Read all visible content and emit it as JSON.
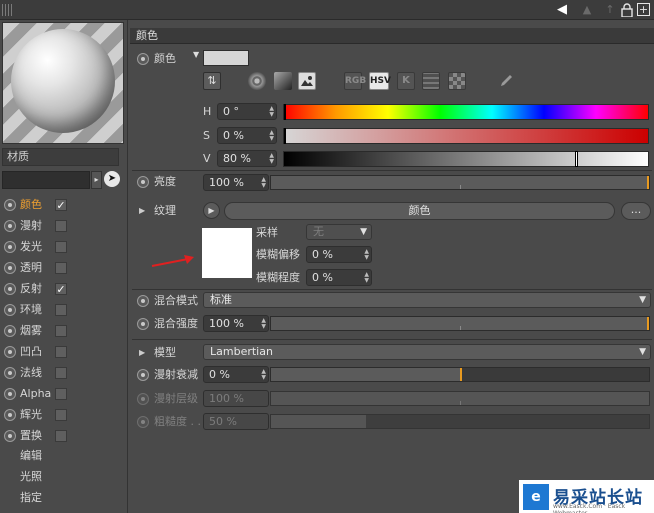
{
  "colors": {
    "accent": "#f0a030",
    "panel": "#4a4a4a",
    "arrow": "#e02020"
  },
  "topbar": {
    "icons": [
      {
        "name": "back-arrow-icon",
        "glyph": "◀"
      },
      {
        "name": "forward-arrow-icon",
        "glyph": "▲"
      },
      {
        "name": "lock-icon",
        "glyph": "🔒"
      },
      {
        "name": "new-panel-icon",
        "glyph": "⊞"
      }
    ]
  },
  "left": {
    "material_name": "材质",
    "channels": [
      {
        "label": "颜色",
        "checked": true,
        "active": true
      },
      {
        "label": "漫射",
        "checked": false,
        "active": false
      },
      {
        "label": "发光",
        "checked": false,
        "active": false
      },
      {
        "label": "透明",
        "checked": false,
        "active": false
      },
      {
        "label": "反射",
        "checked": true,
        "active": false
      },
      {
        "label": "环境",
        "checked": false,
        "active": false
      },
      {
        "label": "烟雾",
        "checked": false,
        "active": false
      },
      {
        "label": "凹凸",
        "checked": false,
        "active": false
      },
      {
        "label": "法线",
        "checked": false,
        "active": false
      },
      {
        "label": "Alpha",
        "checked": false,
        "active": false
      },
      {
        "label": "辉光",
        "checked": false,
        "active": false
      },
      {
        "label": "置换",
        "checked": false,
        "active": false
      }
    ],
    "plain_items": [
      "编辑",
      "光照",
      "指定"
    ]
  },
  "section": {
    "title": "颜色"
  },
  "color": {
    "label": "颜色",
    "swatch": "#d6d6d6",
    "tool_labels": {
      "rgb": "RGB",
      "hsv": "HSV",
      "k": "K"
    },
    "h": {
      "label": "H",
      "value": "0 °"
    },
    "s": {
      "label": "S",
      "value": "0 %"
    },
    "v": {
      "label": "V",
      "value": "80 %"
    },
    "v_position": 0.8
  },
  "brightness": {
    "label": "亮度",
    "value": "100 %",
    "fraction": 1.0
  },
  "texture": {
    "label": "纹理",
    "button": "颜色",
    "more": "...",
    "sampling_label": "采样",
    "sampling_value": "无",
    "blur_offset_label": "模糊偏移",
    "blur_offset_value": "0 %",
    "blur_scale_label": "模糊程度",
    "blur_scale_value": "0 %"
  },
  "mix_mode": {
    "label": "混合模式",
    "value": "标准"
  },
  "mix_strength": {
    "label": "混合强度",
    "value": "100 %",
    "fraction": 1.0
  },
  "model": {
    "label": "模型",
    "value": "Lambertian"
  },
  "diffuse_falloff": {
    "label": "漫射衰减",
    "value": "0 %",
    "fraction": 0.5
  },
  "diffuse_level": {
    "label": "漫射层级",
    "value": "100 %",
    "fraction": 1.0
  },
  "roughness": {
    "label": "粗糙度 . .",
    "value": "50 %",
    "fraction": 0.25
  },
  "badge": {
    "icon": "e",
    "text": "易采站长站",
    "sub": "www.Easck.Com  ·  Easck Webmaster"
  }
}
